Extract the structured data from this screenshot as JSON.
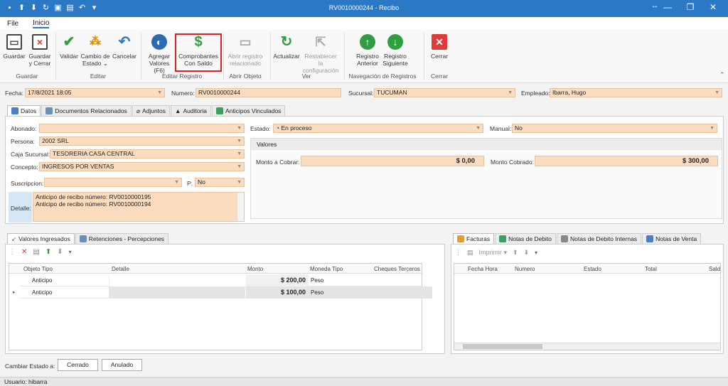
{
  "window": {
    "title": "RV0010000244 - Recibo",
    "qa_icons": [
      "app-icon",
      "up-arrow-icon",
      "down-arrow-icon",
      "refresh-icon",
      "save-icon",
      "save-close-icon",
      "undo-icon",
      "dropdown-icon"
    ],
    "min": "—",
    "max": "❐",
    "close": "✕",
    "resize": "↔"
  },
  "menu": {
    "file": "File",
    "inicio": "Inicio"
  },
  "ribbon": {
    "guardar": "Guardar",
    "guardar_cerrar_1": "Guardar",
    "guardar_cerrar_2": "y Cerrar",
    "validar": "Validar",
    "cambio_1": "Cambio de",
    "cambio_2": "Estado ⌄",
    "cancelar": "Cancelar",
    "agregar_1": "Agregar",
    "agregar_2": "Valores (F6)",
    "comprobantes_1": "Comprobantes",
    "comprobantes_2": "Con Saldo",
    "abrir_1": "Abrir registro",
    "abrir_2": "relacionado",
    "actualizar": "Actualizar",
    "restablecer_1": "Restablecer la",
    "restablecer_2": "configuración",
    "anterior_1": "Registro",
    "anterior_2": "Anterior",
    "siguiente_1": "Registro",
    "siguiente_2": "Siguiente",
    "cerrar": "Cerrar",
    "groups": {
      "guardar": "Guardar",
      "editar": "Editar",
      "editar_registro": "Editar Registro",
      "abrir_objeto": "Abrir Objeto",
      "ver": "Ver",
      "navegacion": "Navegación de Registros",
      "cerrar": "Cerrar"
    }
  },
  "header": {
    "fecha_label": "Fecha:",
    "fecha": "17/8/2021 18:05",
    "numero_label": "Numero:",
    "numero": "RV0010000244",
    "sucursal_label": "Sucursal:",
    "sucursal": "TUCUMAN",
    "empleado_label": "Empleado:",
    "empleado": "Ibarra, Hugo"
  },
  "tabs": [
    "Datos",
    "Documentos Relacionados",
    "Adjuntos",
    "Auditoria",
    "Anticipos Vinculados"
  ],
  "form": {
    "abonado_label": "Abonado:",
    "abonado": "",
    "persona_label": "Persona:",
    "persona": "2002 SRL",
    "caja_label": "Caja Sucursal:",
    "caja": "TESORERIA CASA CENTRAL",
    "concepto_label": "Concepto:",
    "concepto": "INGRESOS POR VENTAS",
    "suscripcion_label": "Suscripcion:",
    "suscripcion": "",
    "p_label": "P:",
    "p": "No",
    "detalle_label": "Detalle:",
    "detalle_1": "Anticipo de recibo número: RV0010000195",
    "detalle_2": "Anticipo de recibo número: RV0010000194",
    "estado_label": "Estado:",
    "estado": "En proceso",
    "manual_label": "Manual:",
    "manual": "No",
    "valores_title": "Valores",
    "monto_cobrar_label": "Monto a Cobrar:",
    "monto_cobrar": "$ 0,00",
    "monto_cobrado_label": "Monto Cobrado:",
    "monto_cobrado": "$ 300,00"
  },
  "left_tabs": [
    "Valores Ingresados",
    "Retenciones - Percepciones"
  ],
  "left_grid": {
    "headers": [
      "Objeto Tipo",
      "Detalle",
      "Monto",
      "Moneda Tipo",
      "Cheques Terceros"
    ],
    "rows": [
      {
        "tipo": "Anticipo",
        "detalle": "",
        "monto": "$ 200,00",
        "moneda": "Peso"
      },
      {
        "tipo": "Anticipo",
        "detalle": "",
        "monto": "$ 100,00",
        "moneda": "Peso"
      }
    ]
  },
  "right_tabs": [
    "Facturas",
    "Notas de Debito",
    "Notas de Debito Internas",
    "Notas de Venta"
  ],
  "right_toolbar": {
    "imprimir": "Imprimir"
  },
  "right_grid": {
    "headers": [
      "Fecha Hora",
      "Numero",
      "Estado",
      "Total",
      "Sald"
    ]
  },
  "footer": {
    "cambiar_label": "Cambiar Estado a:",
    "cerrado": "Cerrado",
    "anulado": "Anulado",
    "usuario": "Usuario: hibarra"
  }
}
